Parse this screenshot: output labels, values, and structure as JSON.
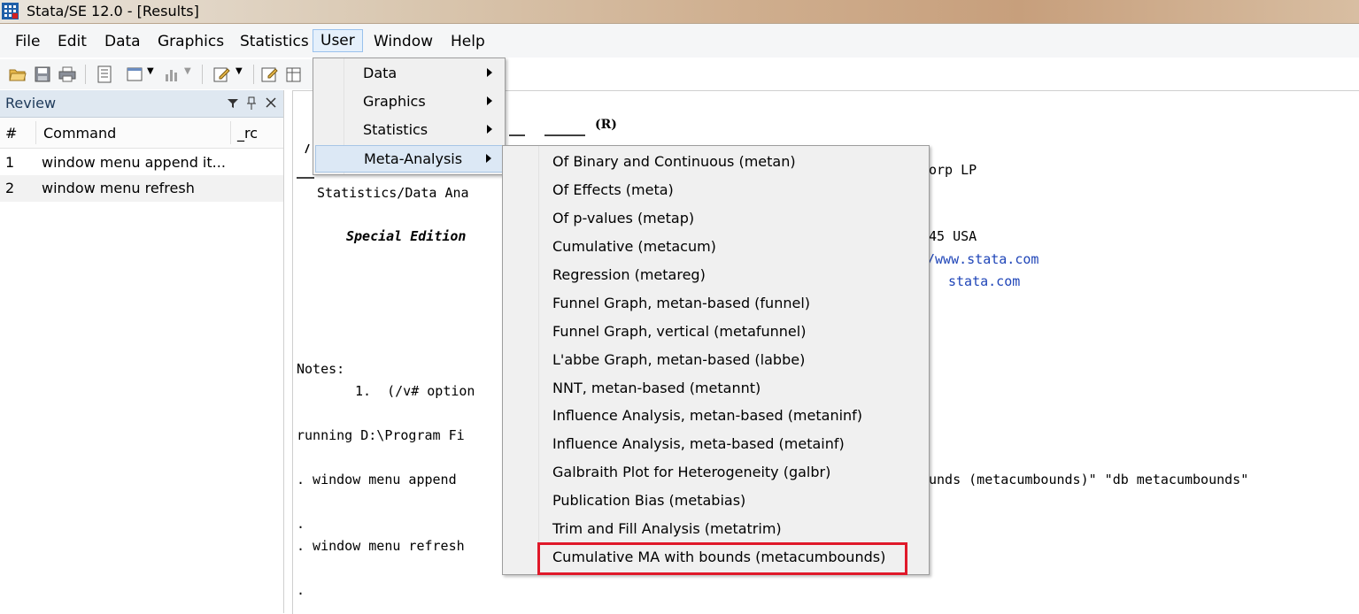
{
  "window": {
    "title": "Stata/SE 12.0 - [Results]"
  },
  "menubar": [
    "File",
    "Edit",
    "Data",
    "Graphics",
    "Statistics",
    "User",
    "Window",
    "Help"
  ],
  "user_menu": {
    "items": [
      {
        "label": "Data",
        "submenu": true
      },
      {
        "label": "Graphics",
        "submenu": true
      },
      {
        "label": "Statistics",
        "submenu": true
      },
      {
        "label": "Meta-Analysis",
        "submenu": true,
        "highlighted": true
      }
    ]
  },
  "meta_menu": {
    "items": [
      "Of Binary and Continuous (metan)",
      "Of Effects (meta)",
      "Of p-values (metap)",
      "Cumulative (metacum)",
      "Regression (metareg)",
      "Funnel Graph, metan-based (funnel)",
      "Funnel Graph, vertical (metafunnel)",
      "L'abbe Graph, metan-based (labbe)",
      "NNT, metan-based (metannt)",
      "Influence Analysis, metan-based (metaninf)",
      "Influence Analysis, meta-based (metainf)",
      "Galbraith Plot for Heterogeneity (galbr)",
      "Publication Bias (metabias)",
      "Trim and Fill Analysis (metatrim)",
      "Cumulative MA with bounds (metacumbounds)"
    ],
    "highlight_color": "#e0192a"
  },
  "review": {
    "title": "Review",
    "columns": {
      "num": "#",
      "command": "Command",
      "rc": "_rc"
    },
    "rows": [
      {
        "num": "1",
        "command": "window menu append it..."
      },
      {
        "num": "2",
        "command": "window menu refresh"
      }
    ]
  },
  "results": {
    "registered": "(R)",
    "corp_fragment": "orp LP",
    "sda_fragment": "Statistics/Data Ana",
    "special_edition": "Special Edition",
    "usa_fragment": "45 USA",
    "url_fragment": "/www.stata.com",
    "email_fragment": "stata.com",
    "notes_label": "Notes:",
    "note1_fragment": "1.  (/v# option",
    "running_fragment": "running D:\\Program Fi",
    "append_cmd_fragment": ". window menu append",
    "append_tail_fragment": "unds (metacumbounds)\" \"db metacumbounds\"",
    "dot1": ".",
    "refresh_fragment": ". window menu refresh",
    "dot2": "."
  }
}
